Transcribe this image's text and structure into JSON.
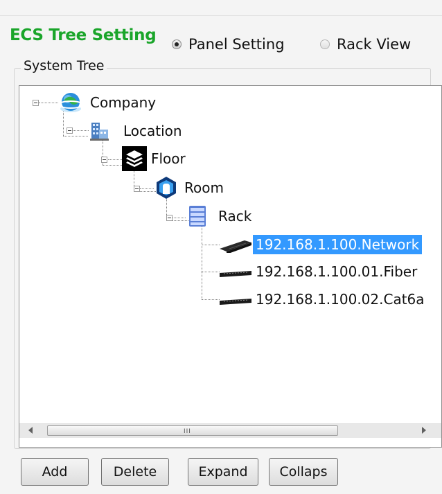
{
  "header": {
    "title": "ECS Tree Setting",
    "radio_panel_label": "Panel Setting",
    "radio_rack_label": "Rack View",
    "selected_mode": "Panel Setting"
  },
  "group": {
    "legend": "System Tree"
  },
  "tree": {
    "company": "Company",
    "location": "Location",
    "floor": "Floor",
    "room": "Room",
    "rack": "Rack",
    "devices": [
      "192.168.1.100.Network",
      "192.168.1.100.01.Fiber",
      "192.168.1.100.02.Cat6a"
    ],
    "selected": "192.168.1.100.Network"
  },
  "scrollbar": {
    "grip": "III"
  },
  "buttons": {
    "add": "Add",
    "delete": "Delete",
    "expand": "Expand",
    "collapse": "Collaps"
  },
  "colors": {
    "title": "#1aa52a",
    "selection": "#3399ff"
  }
}
